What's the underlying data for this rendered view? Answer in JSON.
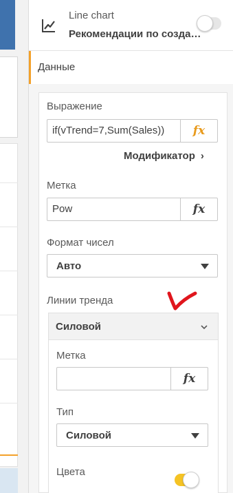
{
  "header": {
    "chart_type": "Line chart",
    "title": "Рекомендации по создании..."
  },
  "section": {
    "label": "Данные"
  },
  "expression": {
    "label": "Выражение",
    "value": "if(vTrend=7,Sum(Sales))",
    "fx": "fx"
  },
  "modifier": {
    "label": "Модификатор",
    "chevron": "›"
  },
  "measure_label": {
    "label": "Метка",
    "value": "Pow",
    "fx": "fx"
  },
  "number_format": {
    "label": "Формат чисел",
    "selected": "Авто"
  },
  "trendlines": {
    "label": "Линии тренда",
    "item_title": "Силовой",
    "item_label": {
      "label": "Метка",
      "value": "",
      "fx": "fx"
    },
    "type": {
      "label": "Тип",
      "selected": "Силовой"
    },
    "colors": {
      "label": "Цвета",
      "toggle_on": true
    }
  },
  "colors": {
    "accent": "#f3a12a",
    "fx_active": "#e89a1c",
    "toggle_on": "#f5c324",
    "annotation": "#e0161d"
  },
  "icons": {
    "chart_type": "line-chart-icon",
    "annotation": "red-checkmark"
  }
}
